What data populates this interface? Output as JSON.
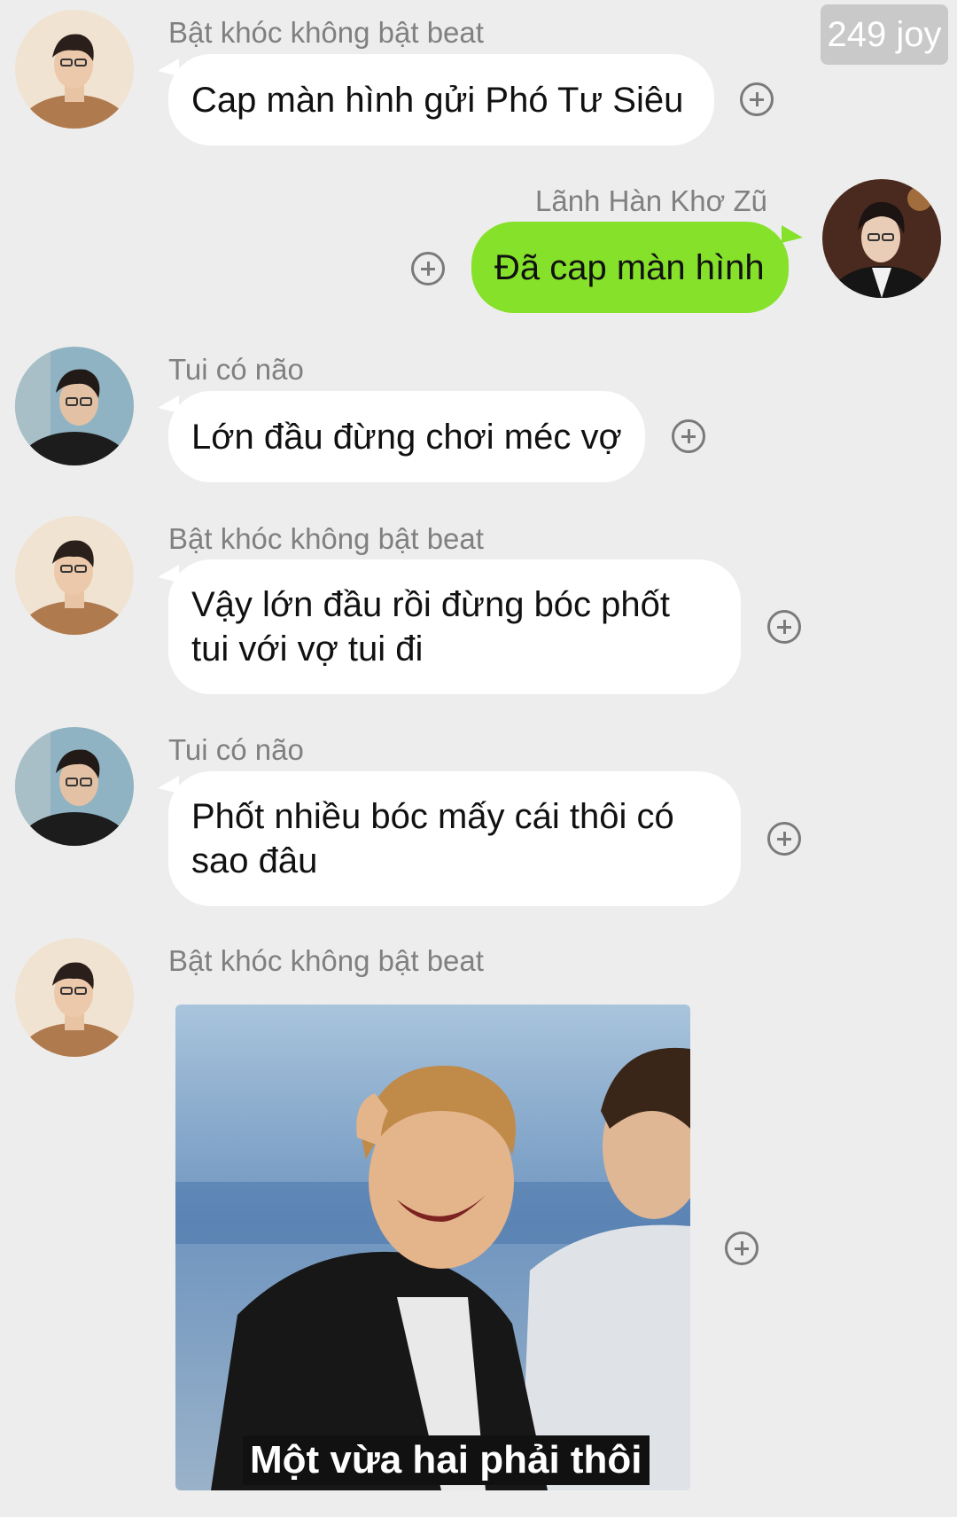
{
  "watermark": "249 joy",
  "messages": [
    {
      "sender": "Bật khóc không bật beat",
      "text": "Cap màn hình gửi Phó Tư Siêu"
    },
    {
      "sender": "Lãnh Hàn Khơ Zũ",
      "text": "Đã cap màn hình"
    },
    {
      "sender": "Tui có não",
      "text": "Lớn đầu đừng chơi méc vợ"
    },
    {
      "sender": "Bật khóc không bật beat",
      "text": "Vậy lớn đầu rồi đừng bóc phốt\ntui với vợ tui đi"
    },
    {
      "sender": "Tui có não",
      "text": "Phốt nhiều bóc mấy cái thôi có\nsao đâu"
    },
    {
      "sender": "Bật khóc không bật beat",
      "image_caption": "Một vừa hai phải thôi"
    }
  ],
  "colors": {
    "background": "#ededed",
    "incoming_bubble": "#ffffff",
    "outgoing_bubble": "#86e12b",
    "sender_text": "#808080"
  },
  "icons": [
    "plus-circle-icon",
    "avatar-icon"
  ]
}
